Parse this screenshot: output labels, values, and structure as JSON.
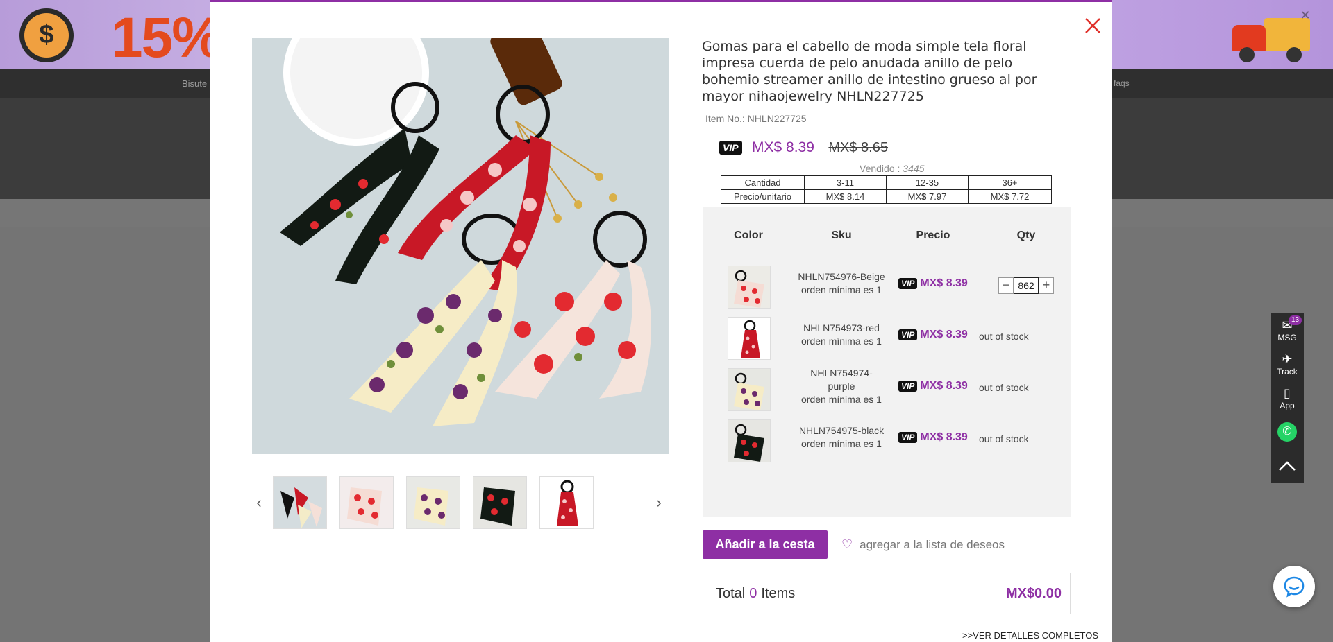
{
  "background": {
    "banner_promo": "15%",
    "nav_left": "Bisute",
    "nav_right": "faqs"
  },
  "side_bar": {
    "msg_label": "MSG",
    "msg_badge": "13",
    "track_label": "Track",
    "app_label": "App"
  },
  "product": {
    "title": "Gomas para el cabello de moda simple tela floral impresa cuerda de pelo anudada anillo de pelo bohemio streamer anillo de intestino grueso al por mayor nihaojewelry NHLN227725",
    "item_no": "Item No.: NHLN227725",
    "vip_label": "VIP",
    "price_now": "MX$ 8.39",
    "price_old": "MX$ 8.65",
    "sold_label": "Vendido :",
    "sold_count": "3445"
  },
  "tiers": {
    "row1": [
      "Cantidad",
      "3-11",
      "12-35",
      "36+"
    ],
    "row2": [
      "Precio/unitario",
      "MX$ 8.14",
      "MX$ 7.97",
      "MX$ 7.72"
    ]
  },
  "sku_table": {
    "headers": {
      "color": "Color",
      "sku": "Sku",
      "price": "Precio",
      "qty": "Qty"
    },
    "rows": [
      {
        "sku": "NHLN754976-Beige",
        "min": "orden mínima es 1",
        "price": "MX$ 8.39",
        "qty": "862",
        "stock": ""
      },
      {
        "sku": "NHLN754973-red",
        "min": "orden mínima es 1",
        "price": "MX$ 8.39",
        "qty": "",
        "stock": "out of stock"
      },
      {
        "sku": "NHLN754974-purple",
        "min": "orden mínima es 1",
        "price": "MX$ 8.39",
        "qty": "",
        "stock": "out of stock"
      },
      {
        "sku": "NHLN754975-black",
        "min": "orden mínima es 1",
        "price": "MX$ 8.39",
        "qty": "",
        "stock": "out of stock"
      }
    ]
  },
  "actions": {
    "add_to_cart": "Añadir a la cesta",
    "wishlist": "agregar a la lista de deseos",
    "total_label": "Total",
    "total_count": "0",
    "total_items": "Items",
    "total_amount": "MX$0.00",
    "details_link": ">>VER DETALLES COMPLETOS"
  },
  "colors": {
    "accent": "#8e2fa4",
    "close": "#e0302a"
  }
}
